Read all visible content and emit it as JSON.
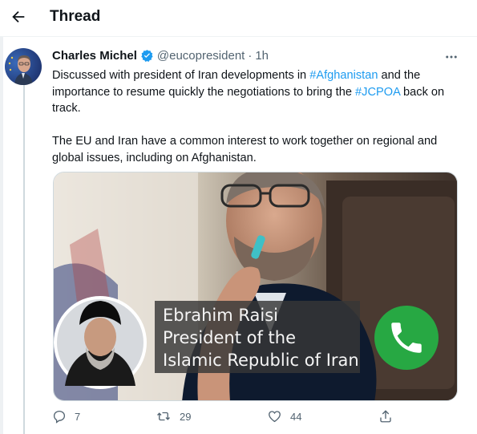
{
  "header": {
    "title": "Thread"
  },
  "tweet": {
    "author_name": "Charles Michel",
    "handle": "@eucopresident",
    "separator": "·",
    "time": "1h",
    "text": {
      "p1_a": "Discussed with president of Iran developments in ",
      "p1_hashtag1": "#Afghanistan",
      "p1_b": " and the importance to resume quickly the negotiations to bring the ",
      "p1_hashtag2": "#JCPOA",
      "p1_c": " back on track.",
      "p2": "The EU and Iran have a common interest to work together on regional and global issues, including on Afghanistan."
    },
    "media": {
      "caption_lines": [
        "Ebrahim Raisi",
        "President of the",
        "Islamic Republic of Iran"
      ]
    },
    "actions": {
      "reply_count": "7",
      "retweet_count": "29",
      "like_count": "44"
    }
  },
  "icons": {
    "back": "arrow-left-icon",
    "verified": "verified-badge-icon",
    "more": "more-horizontal-icon",
    "reply": "reply-icon",
    "retweet": "retweet-icon",
    "like": "heart-icon",
    "share": "share-icon",
    "phone": "phone-icon"
  },
  "colors": {
    "accent": "#1d9bf0",
    "text": "#0f1419",
    "secondary": "#536471",
    "phone_green": "#27a843"
  }
}
